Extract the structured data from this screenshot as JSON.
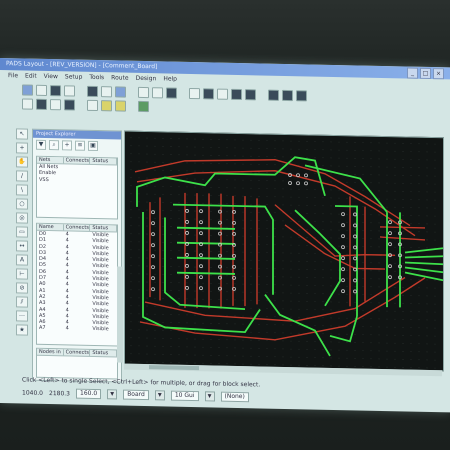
{
  "window": {
    "title": "PADS Layout - [REV_VERSION] - [Comment_Board]"
  },
  "menu": [
    "File",
    "Edit",
    "View",
    "Setup",
    "Tools",
    "Route",
    "Design",
    "Help"
  ],
  "panel": {
    "title": "Project Explorer",
    "table1": {
      "headers": [
        "Nets",
        "Connects",
        "Status"
      ],
      "rows": [
        [
          "All Nets",
          ""
        ],
        [
          "Enable",
          ""
        ],
        [
          "VSS",
          ""
        ]
      ]
    },
    "table2": {
      "headers": [
        "Name",
        "Connects",
        "Status"
      ],
      "rows": [
        [
          "D0",
          "4",
          "Visible"
        ],
        [
          "D1",
          "4",
          "Visible"
        ],
        [
          "D2",
          "4",
          "Visible"
        ],
        [
          "D3",
          "4",
          "Visible"
        ],
        [
          "D4",
          "4",
          "Visible"
        ],
        [
          "D5",
          "4",
          "Visible"
        ],
        [
          "D6",
          "4",
          "Visible"
        ],
        [
          "D7",
          "4",
          "Visible"
        ],
        [
          "A0",
          "4",
          "Visible"
        ],
        [
          "A1",
          "4",
          "Visible"
        ],
        [
          "A2",
          "4",
          "Visible"
        ],
        [
          "A3",
          "4",
          "Visible"
        ],
        [
          "A4",
          "4",
          "Visible"
        ],
        [
          "A5",
          "4",
          "Visible"
        ],
        [
          "A6",
          "4",
          "Visible"
        ],
        [
          "A7",
          "4",
          "Visible"
        ]
      ]
    },
    "table3": {
      "headers": [
        "Nodes in",
        "Connects",
        "Status"
      ]
    }
  },
  "status": {
    "text": "Click <Left> to single Select, <Ctrl+Left> for multiple, or drag for block select."
  },
  "bottom": {
    "coord_x": "1040.0",
    "coord_y": "2180.3",
    "width": "160.0",
    "grid": "Board",
    "layer": "10 Gui",
    "mode": "(None)"
  },
  "colors": {
    "board_bg": "#111514",
    "top_copper": "#c23a2a",
    "bottom_copper": "#3de14a",
    "pad": "#c8c8c8"
  }
}
